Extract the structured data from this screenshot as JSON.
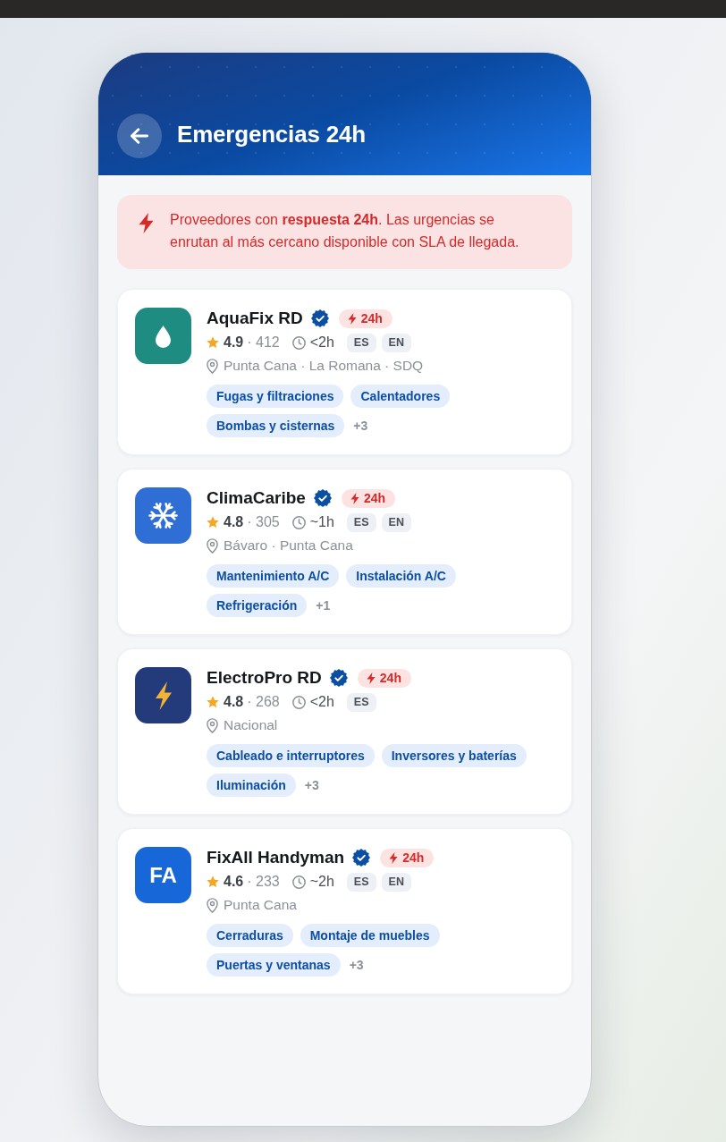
{
  "header": {
    "title": "Emergencias 24h"
  },
  "notice": {
    "text": "Proveedores con **respuesta 24h**. Las urgencias se enrutan al más cercano disponible con SLA de llegada."
  },
  "providers": [
    {
      "name": "AquaFix RD",
      "verified": true,
      "badge": "24h",
      "logo": {
        "kind": "drop",
        "color": "#1f8c81"
      },
      "rating": "4.9",
      "reviews": "· 412",
      "response_time": "<2h",
      "languages": [
        "ES",
        "EN"
      ],
      "locations": "Punta Cana · La Romana · SDQ",
      "tags": [
        "Fugas y filtraciones",
        "Calentadores",
        "Bombas y cisternas"
      ],
      "more": "+3"
    },
    {
      "name": "ClimaCaribe",
      "verified": true,
      "badge": "24h",
      "logo": {
        "kind": "snowflake",
        "color": "#2f6fd5"
      },
      "rating": "4.8",
      "reviews": "· 305",
      "response_time": "~1h",
      "languages": [
        "ES",
        "EN"
      ],
      "locations": "Bávaro · Punta Cana",
      "tags": [
        "Mantenimiento A/C",
        "Instalación A/C",
        "Refrigeración"
      ],
      "more": "+1"
    },
    {
      "name": "ElectroPro RD",
      "verified": true,
      "badge": "24h",
      "logo": {
        "kind": "bolt",
        "color": "#233a7b"
      },
      "rating": "4.8",
      "reviews": "· 268",
      "response_time": "<2h",
      "languages": [
        "ES"
      ],
      "locations": "Nacional",
      "tags": [
        "Cableado e interruptores",
        "Inversores y baterías",
        "Iluminación"
      ],
      "more": "+3"
    },
    {
      "name": "FixAll Handyman",
      "verified": true,
      "badge": "24h",
      "logo": {
        "kind": "initials",
        "color": "#1767d8",
        "text": "FA"
      },
      "rating": "4.6",
      "reviews": "· 233",
      "response_time": "~2h",
      "languages": [
        "ES",
        "EN"
      ],
      "locations": "Punta Cana",
      "tags": [
        "Cerraduras",
        "Montaje de muebles",
        "Puertas y ventanas"
      ],
      "more": "+3"
    }
  ]
}
